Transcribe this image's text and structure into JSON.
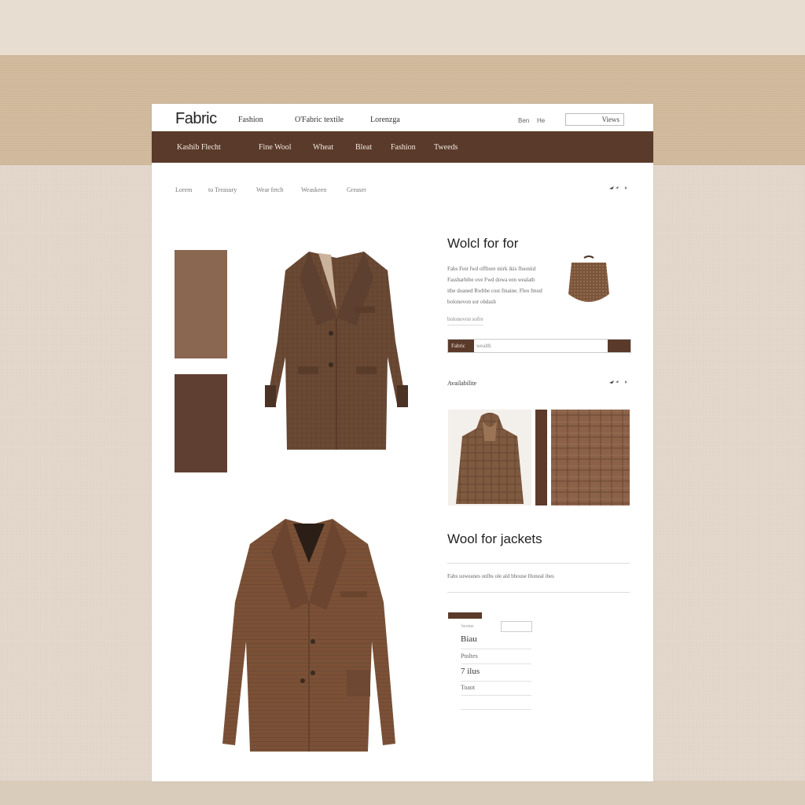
{
  "header": {
    "brand": "Fabric",
    "nav": [
      "Fashion",
      "O'Fabric textile",
      "Lorenzga"
    ],
    "mini_links": [
      "Ben",
      "He"
    ],
    "search_value": "Views"
  },
  "categories": [
    "Kashib Flecht",
    "Fine Wool",
    "Wheat",
    "Bleat",
    "Fashion",
    "Tweeds"
  ],
  "breadcrumbs": [
    "Lorem",
    "to Treasury",
    "Wear fetch",
    "Weaskeen",
    "Greaser"
  ],
  "product": {
    "title": "Wolcl for for",
    "description_lines": [
      "Fabs Fest fwd offbore mirk ikis fluoniid",
      "Fassbarbibe ove Fwd dowa een wealath",
      "ithe doaned Rwbbe cost finaine. Fleo fmod",
      "bolonovon sor obdash"
    ],
    "link_text": "bolonovon sofre",
    "swatch_label": "Fabric",
    "swatch_field": "wealth",
    "availability": "Availabilite",
    "colors": {
      "accent": "#5a3a2a",
      "swatch_light": "#8a6751",
      "swatch_dark": "#5f3f32"
    }
  },
  "section2": {
    "title": "Wool for jackets",
    "description": "Fabs suweanes onlbs ole ald bhouse Honeal ibes",
    "option_label": "bsome",
    "prices": [
      "Biau",
      "Ptoltes",
      "7 ilus",
      "Toaot"
    ]
  }
}
